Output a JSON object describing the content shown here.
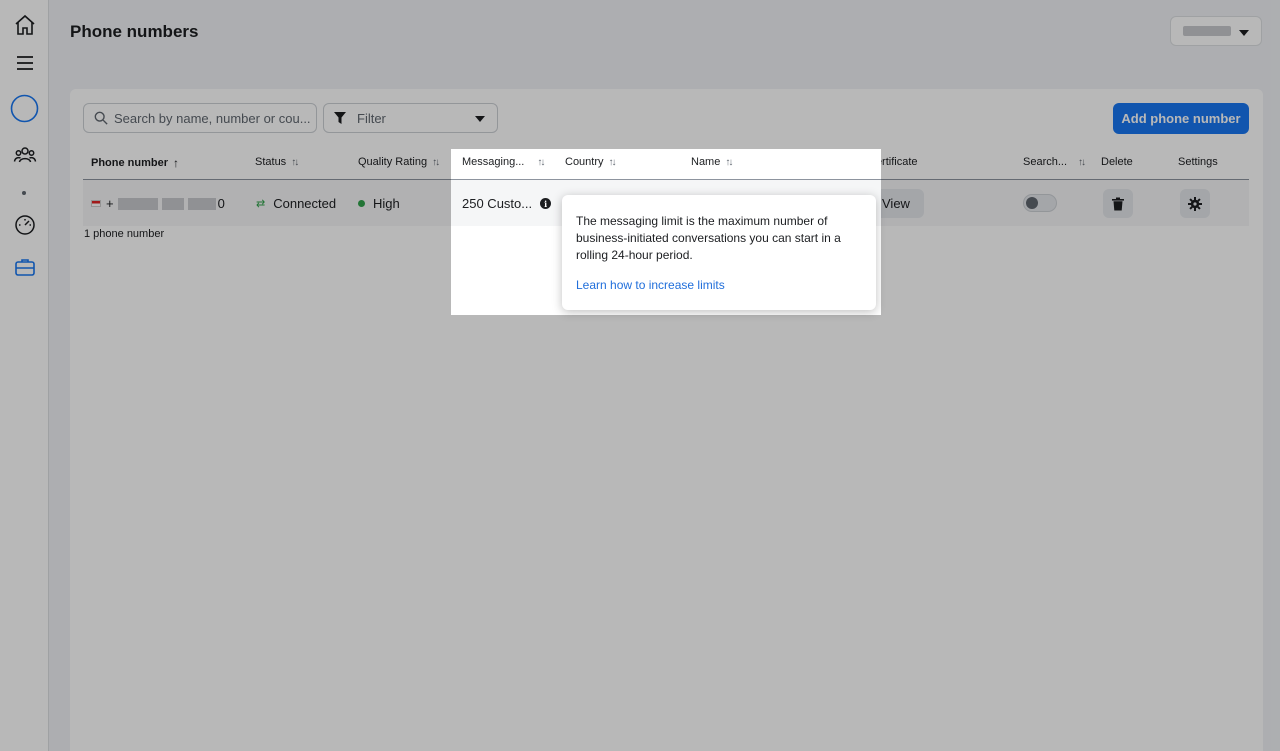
{
  "header": {
    "title": "Phone numbers"
  },
  "toolbar": {
    "search_placeholder": "Search by name, number or cou...",
    "filter_label": "Filter",
    "add_button_label": "Add phone number"
  },
  "table": {
    "columns": {
      "phone_number": "Phone number",
      "status": "Status",
      "quality_rating": "Quality Rating",
      "messaging": "Messaging...",
      "country": "Country",
      "name": "Name",
      "certificate": "Certificate",
      "search": "Search...",
      "delete": "Delete",
      "settings": "Settings"
    },
    "sort_asc": "↑",
    "sort_both": "↑↓",
    "rows": [
      {
        "phone_prefix": "+",
        "phone_suffix": "0",
        "status": "Connected",
        "quality": "High",
        "messaging": "250 Custo...",
        "certificate_button": "View"
      }
    ],
    "count_label": "1 phone number"
  },
  "tooltip": {
    "text": "The messaging limit is the maximum number of business-initiated conversations you can start in a rolling 24-hour period.",
    "link": "Learn how to increase limits"
  },
  "icons": {
    "info": "i",
    "status": "⇄"
  },
  "colors": {
    "accent": "#1877f2",
    "link": "#216fdb",
    "success": "#31a24c"
  }
}
